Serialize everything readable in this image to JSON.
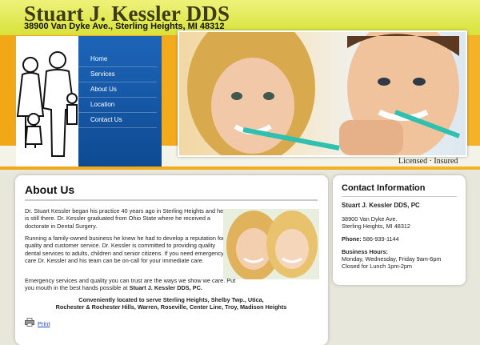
{
  "site": {
    "title": "Stuart J. Kessler DDS",
    "address": "38900 Van Dyke Ave., Sterling Heights, MI 48312"
  },
  "nav": {
    "items": [
      {
        "label": "Home"
      },
      {
        "label": "Services"
      },
      {
        "label": "About Us"
      },
      {
        "label": "Location"
      },
      {
        "label": "Contact Us"
      }
    ]
  },
  "tagline": "Licensed · Insured",
  "main": {
    "heading": "About Us",
    "paragraph1": "Dr. Stuart Kessler began his practice 40 years ago in Sterling Heights and he is still there. Dr. Kessler graduated from Ohio State where he received a doctorate in Dental Surgery.",
    "paragraph2": "Running a family-owned business he knew he had to develop a reputation for quality and customer service. Dr. Kessler is committed to providing quality dental services to adults, children and senior citizens. If you need emergency care Dr. Kessler and his team can be on-call for your immediate care.",
    "paragraph3_text": "Emergency services and quality you can trust are the ways we show we care. Put you mouth in the best hands possible at ",
    "paragraph3_bold": "Stuart J. Kessler DDS, PC.",
    "served_line1": "Conveniently located to serve Sterling Heights, Shelby Twp., Utica,",
    "served_line2": "Rochester & Rochester Hills, Warren, Roseville, Center Line, Troy, Madison Heights",
    "print_label": "Print"
  },
  "contact": {
    "heading": "Contact Information",
    "name": "Stuart J. Kessler DDS, PC",
    "address_line1": "38900 Van Dyke Ave.",
    "address_line2": "Sterling Heights, MI 48312",
    "phone_label": "Phone:",
    "phone": "586-939-1144",
    "hours_heading": "Business Hours:",
    "hours_line1": "Monday, Wednesday, Friday 9am-6pm",
    "hours_line2": "Closed for Lunch 1pm-2pm"
  },
  "colors": {
    "header": "#dde63f",
    "band": "#f3ad1e",
    "nav": "#1558a8",
    "link": "#1b4ea8"
  }
}
